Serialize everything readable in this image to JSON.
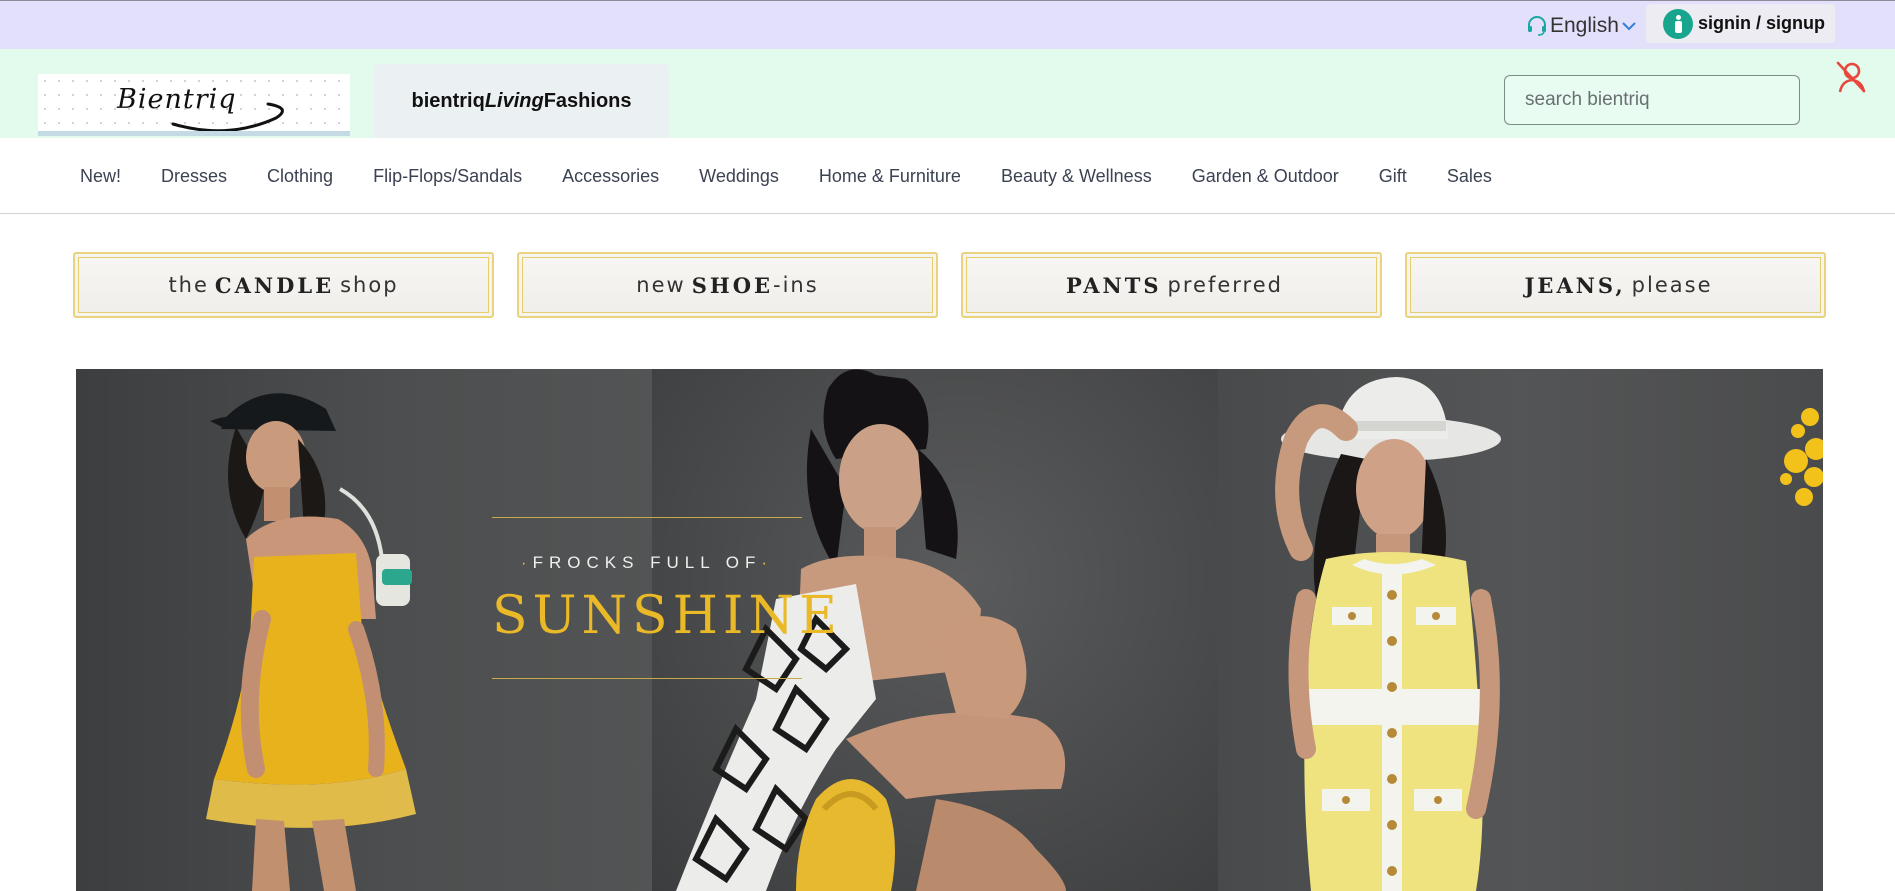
{
  "topbar": {
    "language": {
      "label": "English",
      "icon": "headset-icon",
      "caret": "chevron-down-icon"
    },
    "account": {
      "label": "signin / signup",
      "icon": "user-icon"
    }
  },
  "header": {
    "logo_text": "Bientriq",
    "brand": {
      "part1": "bientriq",
      "part2": "Living",
      "part3": "Fashions"
    },
    "search": {
      "placeholder": "search bientriq",
      "value": ""
    },
    "status_icon": "user-off-icon"
  },
  "nav": {
    "items": [
      "New!",
      "Dresses",
      "Clothing",
      "Flip-Flops/Sandals",
      "Accessories",
      "Weddings",
      "Home & Furniture",
      "Beauty & Wellness",
      "Garden & Outdoor",
      "Gift",
      "Sales"
    ]
  },
  "promos": [
    {
      "pre": "the",
      "bold": "CANDLE",
      "post": "shop"
    },
    {
      "pre": "new",
      "bold": "SHOE",
      "post": "-ins"
    },
    {
      "pre": "",
      "bold": "PANTS",
      "post": "preferred"
    },
    {
      "pre": "",
      "bold": "JEANS,",
      "post": "please"
    }
  ],
  "hero": {
    "kicker": "FROCKS FULL OF",
    "headline": "SUNSHINE"
  },
  "colors": {
    "topbar_bg": "#e3e0fb",
    "header_bg": "#e2fbec",
    "accent_teal": "#17a58e",
    "gold": "#eab928",
    "alert_red": "#e8473d"
  }
}
